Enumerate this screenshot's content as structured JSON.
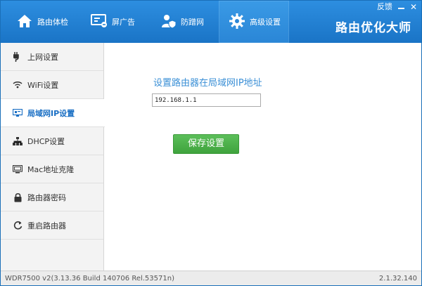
{
  "topbar": {
    "feedback_label": "反馈"
  },
  "nav": {
    "items": [
      {
        "label": "路由体检",
        "icon": "home-icon"
      },
      {
        "label": "屏广告",
        "icon": "monitor-icon"
      },
      {
        "label": "防蹭网",
        "icon": "user-shield-icon"
      },
      {
        "label": "高级设置",
        "icon": "gear-icon"
      }
    ],
    "active_index": 3
  },
  "brand": "路由优化大师",
  "sidebar": {
    "items": [
      {
        "label": "上网设置",
        "icon": "plug-icon"
      },
      {
        "label": "WiFi设置",
        "icon": "wifi-icon"
      },
      {
        "label": "局域网IP设置",
        "icon": "network-icon"
      },
      {
        "label": "DHCP设置",
        "icon": "dhcp-icon"
      },
      {
        "label": "Mac地址克隆",
        "icon": "mac-icon"
      },
      {
        "label": "路由器密码",
        "icon": "lock-icon"
      },
      {
        "label": "重启路由器",
        "icon": "restart-icon"
      }
    ],
    "active_index": 2
  },
  "main": {
    "title": "设置路由器在局域网IP地址",
    "ip_value": "192.168.1.1",
    "save_label": "保存设置"
  },
  "status": {
    "left": "WDR7500 v2(3.13.36 Build 140706 Rel.53571n)",
    "right": "2.1.32.140"
  },
  "colors": {
    "header": "#1f7fd0",
    "active_text": "#1a6fc4",
    "save_button": "#4aad47",
    "title_text": "#3a8fd6"
  }
}
